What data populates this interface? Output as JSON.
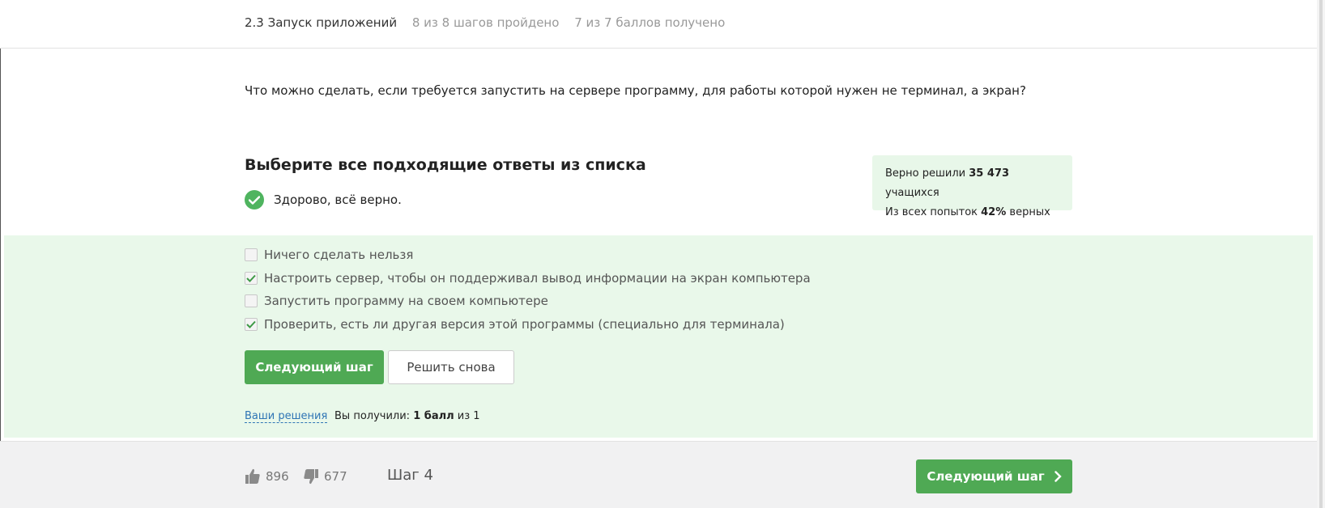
{
  "breadcrumb": {
    "lesson": "2.3 Запуск приложений",
    "steps_progress": "8 из 8 шагов пройдено",
    "points": "7 из 7 баллов  получено"
  },
  "question": "Что можно сделать, если требуется запустить на сервере программу, для работы которой нужен не терминал, а экран?",
  "task": {
    "heading": "Выберите все подходящие ответы из списка",
    "result_text": "Здорово, всё верно."
  },
  "stats": {
    "solved_prefix": "Верно решили",
    "solved_count": "35 473",
    "solved_suffix": "учащихся",
    "attempts_prefix": "Из всех попыток",
    "attempts_percent": "42%",
    "attempts_suffix": "верных"
  },
  "options": [
    {
      "label": "Ничего сделать нельзя",
      "checked": false
    },
    {
      "label": "Настроить сервер, чтобы он поддерживал вывод информации на экран компьютера",
      "checked": true
    },
    {
      "label": "Запустить программу на своем компьютере",
      "checked": false
    },
    {
      "label": "Проверить, есть ли другая версия этой программы (специально для терминала)",
      "checked": true
    }
  ],
  "buttons": {
    "next_step": "Следующий шаг",
    "retry": "Решить снова"
  },
  "submission": {
    "solutions_link": "Ваши решения",
    "score_prefix": "Вы получили:",
    "score_value": "1 балл",
    "score_suffix": "из 1"
  },
  "footer": {
    "likes": "896",
    "dislikes": "677",
    "step_label": "Шаг 4",
    "next_button": "Следующий шаг"
  },
  "colors": {
    "accent_green": "#4fa954",
    "panel_green": "#e9f8ea",
    "link_blue": "#2f75b5"
  }
}
